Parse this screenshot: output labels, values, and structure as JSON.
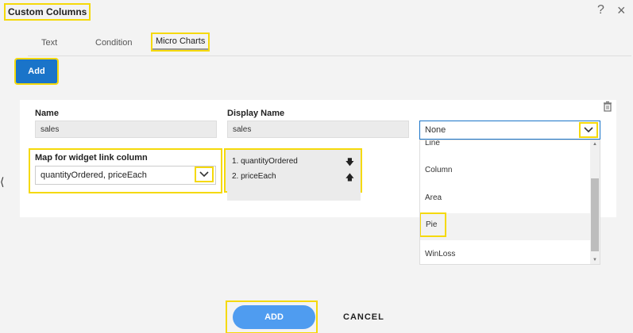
{
  "dialog": {
    "title": "Custom Columns",
    "help_icon": "question-mark-icon",
    "close_icon": "close-icon"
  },
  "tabs": [
    {
      "label": "Text"
    },
    {
      "label": "Condition"
    },
    {
      "label": "Micro Charts",
      "active": true
    }
  ],
  "toolbar": {
    "add_label": "Add"
  },
  "form": {
    "name_label": "Name",
    "name_value": "sales",
    "display_name_label": "Display Name",
    "display_name_value": "sales",
    "chart_type_value": "None",
    "chart_type_options": [
      "Line",
      "Column",
      "Area",
      "Pie",
      "WinLoss"
    ],
    "map_label": "Map for widget link column",
    "map_value": "quantityOrdered, priceEach",
    "order_items": [
      "1. quantityOrdered",
      "2. priceEach"
    ]
  },
  "footer": {
    "add_label": "ADD",
    "cancel_label": "CANCEL"
  },
  "colors": {
    "highlight": "#f5d90a",
    "primary": "#1a74c9",
    "button_light": "#4f9cf0"
  }
}
